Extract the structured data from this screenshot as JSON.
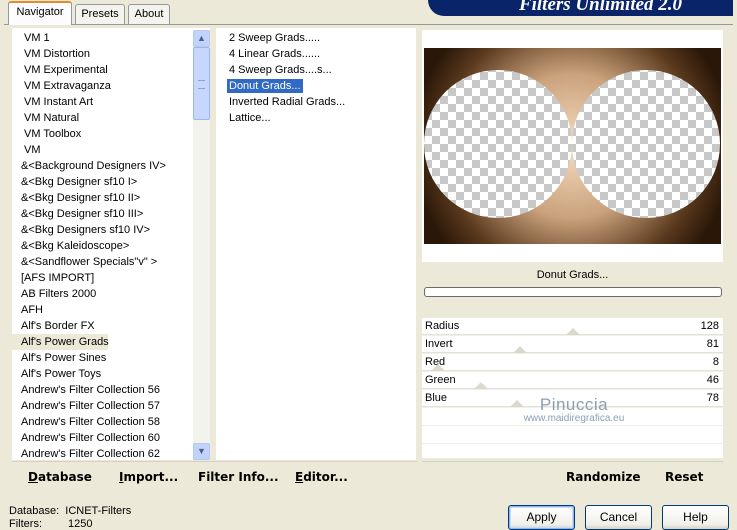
{
  "tabs": [
    {
      "label": "Navigator",
      "active": true
    },
    {
      "label": "Presets",
      "active": false
    },
    {
      "label": "About",
      "active": false
    }
  ],
  "banner_title": "Filters Unlimited 2.0",
  "categories": [
    "VM 1",
    "VM Distortion",
    "VM Experimental",
    "VM Extravaganza",
    "VM Instant Art",
    "VM Natural",
    "VM Toolbox",
    "VM",
    "&<Background Designers IV>",
    "&<Bkg Designer sf10 I>",
    "&<Bkg Designer sf10 II>",
    "&<Bkg Designer sf10 III>",
    "&<Bkg Designers sf10 IV>",
    "&<Bkg Kaleidoscope>",
    "&<Sandflower Specials\"v\" >",
    "[AFS IMPORT]",
    "AB Filters 2000",
    "AFH",
    "Alf's Border FX",
    "Alf's Power Grads",
    "Alf's Power Sines",
    "Alf's Power Toys",
    "Andrew's Filter Collection 56",
    "Andrew's Filter Collection 57",
    "Andrew's Filter Collection 58",
    "Andrew's Filter Collection 60",
    "Andrew's Filter Collection 62"
  ],
  "selected_category": "Alf's Power Grads",
  "filters": [
    "2 Sweep Grads.....",
    "4 Linear Grads......",
    "4 Sweep Grads....s...",
    "Donut Grads...",
    "Inverted Radial Grads...",
    "Lattice..."
  ],
  "selected_filter": "Donut Grads...",
  "preview_filter_name": "Donut Grads...",
  "progress_value": 0,
  "sliders": [
    {
      "label": "Radius",
      "value": 128,
      "max": 255
    },
    {
      "label": "Invert",
      "value": 81,
      "max": 255
    },
    {
      "label": "Red",
      "value": 8,
      "max": 255
    },
    {
      "label": "Green",
      "value": 46,
      "max": 255
    },
    {
      "label": "Blue",
      "value": 78,
      "max": 255
    }
  ],
  "watermark": {
    "line1": "Pinuccia",
    "line2": "www.maidiregrafica.eu"
  },
  "left_buttons": [
    {
      "key": "D",
      "rest": "atabase"
    },
    {
      "key": "I",
      "rest": "mport..."
    },
    {
      "key": "",
      "rest": "Filter Info..."
    },
    {
      "key": "E",
      "rest": "ditor..."
    }
  ],
  "right_buttons": {
    "randomize": "Randomize",
    "reset": "Reset"
  },
  "status": {
    "database_label": "Database:",
    "database_value": "ICNET-Filters",
    "filters_label": "Filters:",
    "filters_value": "1250"
  },
  "dialog_buttons": {
    "apply": "Apply",
    "cancel": "Cancel",
    "help": "Help"
  },
  "colors": {
    "selection": "#316ac5",
    "banner": "#0a246a",
    "gradient_light": "#f2d6b8",
    "gradient_dark": "#3a2410"
  }
}
